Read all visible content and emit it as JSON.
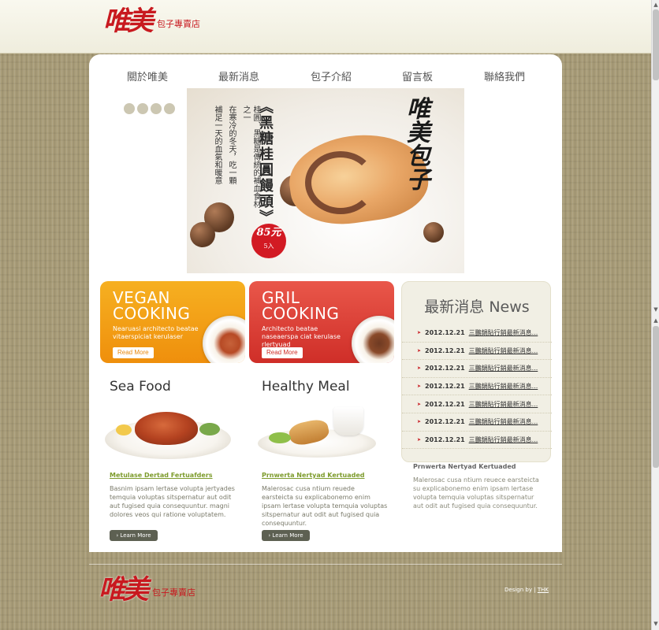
{
  "header": {
    "logo_mark": "唯美",
    "logo_sub": "包子專賣店"
  },
  "nav": {
    "items": [
      {
        "label": "關於唯美"
      },
      {
        "label": "最新消息"
      },
      {
        "label": "包子介紹"
      },
      {
        "label": "留言板"
      },
      {
        "label": "聯絡我們"
      }
    ]
  },
  "banner": {
    "title": "《黑糖桂圓饅頭》",
    "brand": "唯美包子",
    "text_1": "桂圓、黑糖是傳統的補血食材之一",
    "text_2": "在寒冷的冬天，吃一顆",
    "text_3": "補足一天的血氣和暖意",
    "price": "85元",
    "price_unit": "5入"
  },
  "promos": [
    {
      "title_1": "VEGAN",
      "title_2": "COOKING",
      "desc": "Nearuasi architecto beatae vitaerspiciat kerulaser",
      "button": "Read More",
      "color": "#f39f18"
    },
    {
      "title_1": "GRIL",
      "title_2": "COOKING",
      "desc": "Architecto beatae naseaerspa ciat kerulase rlertyuad",
      "button": "Read More",
      "color": "#dc3d35"
    }
  ],
  "news": {
    "title": "最新消息 News",
    "items": [
      {
        "date": "2012.12.21",
        "text": "三鵬鍋貼行銷最新消息..."
      },
      {
        "date": "2012.12.21",
        "text": "三鵬鍋貼行銷最新消息..."
      },
      {
        "date": "2012.12.21",
        "text": "三鵬鍋貼行銷最新消息..."
      },
      {
        "date": "2012.12.21",
        "text": "三鵬鍋貼行銷最新消息..."
      },
      {
        "date": "2012.12.21",
        "text": "三鵬鍋貼行銷最新消息..."
      },
      {
        "date": "2012.12.21",
        "text": "三鵬鍋貼行銷最新消息..."
      },
      {
        "date": "2012.12.21",
        "text": "三鵬鍋貼行銷最新消息..."
      }
    ]
  },
  "columns": [
    {
      "title": "Sea Food",
      "subtitle": "Metulase Dertad Fertuafders",
      "text": "Basnim ipsam lertase volupta jertyades temquia voluptas sitspernatur aut odit aut fugised quia consequuntur. magni dolores veos qui ratione voluptatem.",
      "button": "› Learn More"
    },
    {
      "title": "Healthy Meal",
      "subtitle": "Prnwerta Nertyad Kertuaded",
      "text": "Malerosac cusa ntium reuede earsteicta su explicabonemo enim ipsam lertase volupta temquia voluptas sitspernatur aut odit aut fugised quia consequuntur.",
      "button": "› Learn More"
    }
  ],
  "sidebar": {
    "subtitle": "Prnwerta Nertyad Kertuaded",
    "text": "Malerosac cusa ntium reuece earsteicta su explicabonemo enim ipsam lertase volupta temquia voluptas sitspernatur aut odit aut fugised quia consequuntur."
  },
  "footer": {
    "logo_mark": "唯美",
    "logo_sub": "包子專賣店",
    "credit_label": "Design by",
    "credit_sep": "|",
    "credit_link": "THK"
  },
  "colors": {
    "brand_red": "#c8191f",
    "accent_green": "#7d9b2c",
    "background_mat": "#a89c78"
  },
  "icons": [
    "slider-dot",
    "bullet-arrow",
    "scroll-arrow"
  ]
}
